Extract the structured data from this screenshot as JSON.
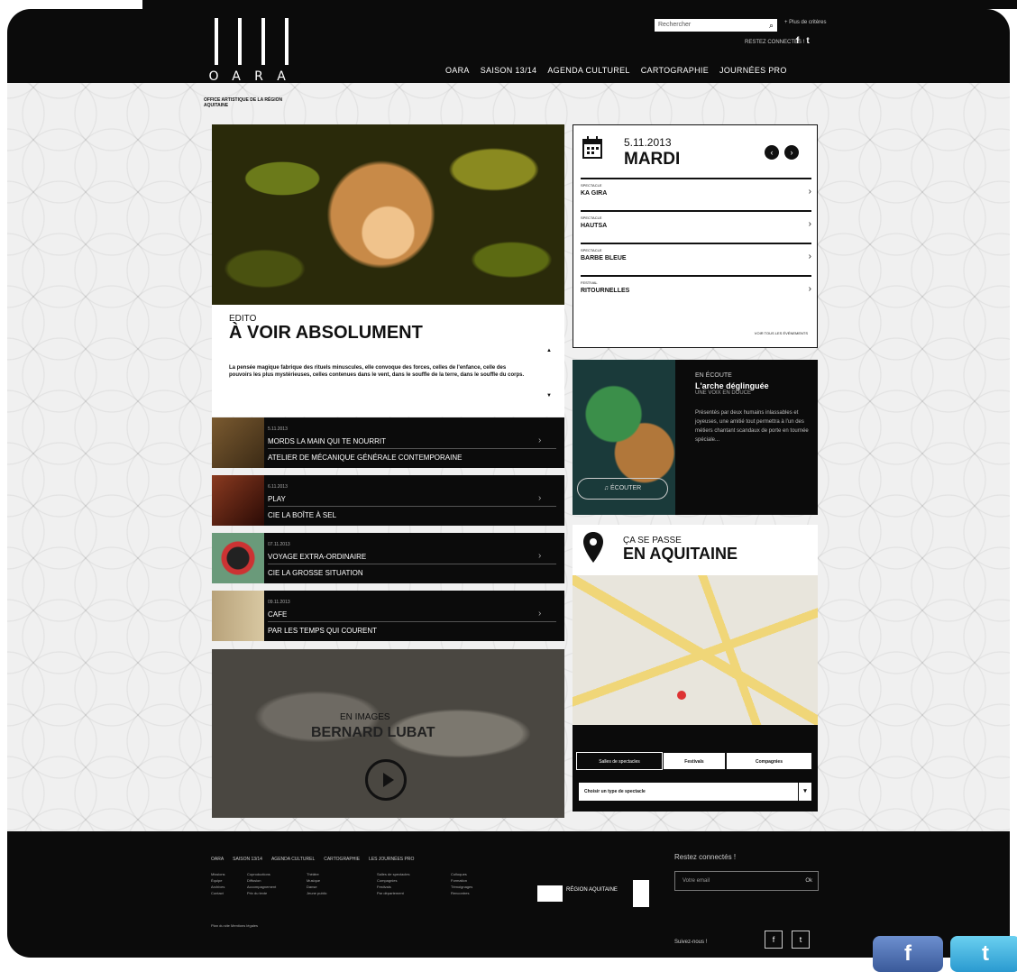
{
  "header": {
    "search_placeholder": "Rechercher",
    "plus_label": "+ Plus de critères",
    "connect_label": "RESTEZ CONNECTÉS !",
    "social_icons": [
      "facebook-icon",
      "twitter-icon"
    ],
    "nav": [
      "OARA",
      "SAISON 13/14",
      "AGENDA CULTUREL",
      "CARTOGRAPHIE",
      "JOURNÉES PRO"
    ]
  },
  "logo": {
    "letters": [
      "O",
      "A",
      "R",
      "A"
    ],
    "subtitle": "OFFICE ARTISTIQUE DE LA RÉGION AQUITAINE"
  },
  "edito": {
    "kicker": "EDITO",
    "title": "À VOIR ABSOLUMENT",
    "body": "La pensée magique fabrique des rituels minuscules, elle convoque des forces, celles de l'enfance, celle des pouvoirs les plus mystérieuses, celles contenues dans le vent, dans le souffle de la terre, dans le souffle du corps."
  },
  "events": [
    {
      "date": "5.11.2013",
      "line1": "MORDS LA MAIN QUI TE NOURRIT",
      "line2": "ATELIER DE MÉCANIQUE GÉNÉRALE CONTEMPORAINE"
    },
    {
      "date": "6.11.2013",
      "line1": "PLAY",
      "line2": "CIE LA BOÎTE À SEL"
    },
    {
      "date": "07.11.2013",
      "line1": "VOYAGE EXTRA-ORDINAIRE",
      "line2": "CIE LA GROSSE SITUATION"
    },
    {
      "date": "09.11.2013",
      "line1": "CAFE",
      "line2": "PAR LES TEMPS QUI COURENT"
    }
  ],
  "video": {
    "kicker": "EN IMAGES",
    "name": "BERNARD LUBAT"
  },
  "agenda": {
    "date": "5.11.2013",
    "day": "MARDI",
    "items": [
      {
        "cat": "SPECTACLE",
        "name": "KA GIRA"
      },
      {
        "cat": "SPECTACLE",
        "name": "HAUTSA"
      },
      {
        "cat": "SPECTACLE",
        "name": "BARBE BLEUE"
      },
      {
        "cat": "FESTIVAL",
        "name": "RITOURNELLES"
      }
    ],
    "all_label": "VOIR TOUS LES ÉVÉNEMENTS"
  },
  "ecoute": {
    "kicker": "EN ÉCOUTE",
    "title": "L'arche déglinguée",
    "subtitle": "UNE VOIX EN DOUCE",
    "desc": "Présentés par deux humains inlassables et joyeuses, une amitié tout permettra à l'un des métiers chantant scandaux de porte en tournée spéciale...",
    "button": "ÉCOUTER"
  },
  "aquitaine": {
    "kicker": "ÇA SE PASSE",
    "title": "EN AQUITAINE",
    "tabs": [
      "Salles de spectacles",
      "Festivals",
      "Compagnies"
    ],
    "select": "Choisir un type de spectacle"
  },
  "footer": {
    "nav": [
      "OARA",
      "SAISON 13/14",
      "AGENDA CULTUREL",
      "CARTOGRAPHIE",
      "LES JOURNÉES PRO"
    ],
    "col1": [
      "Missions",
      "Équipe",
      "Archives",
      "Contact"
    ],
    "col2": [
      "Coproductions",
      "Diffusion",
      "Accompagnement",
      "Prix du texte"
    ],
    "col3": [
      "Théâtre",
      "Musique",
      "Danse",
      "Jeune public"
    ],
    "col4": [
      "Salles de spectacles",
      "Compagnies",
      "Festivals",
      "Par département"
    ],
    "col5": [
      "Colloques",
      "Formation",
      "Témoignages",
      "Rencontres"
    ],
    "legal": "Plan du site     Mentions légales",
    "region": "RÉGION AQUITAINE",
    "stay": "Restez connectés !",
    "email_placeholder": "Votre email",
    "ok": "Ok",
    "follow": "Suivez-nous !"
  }
}
